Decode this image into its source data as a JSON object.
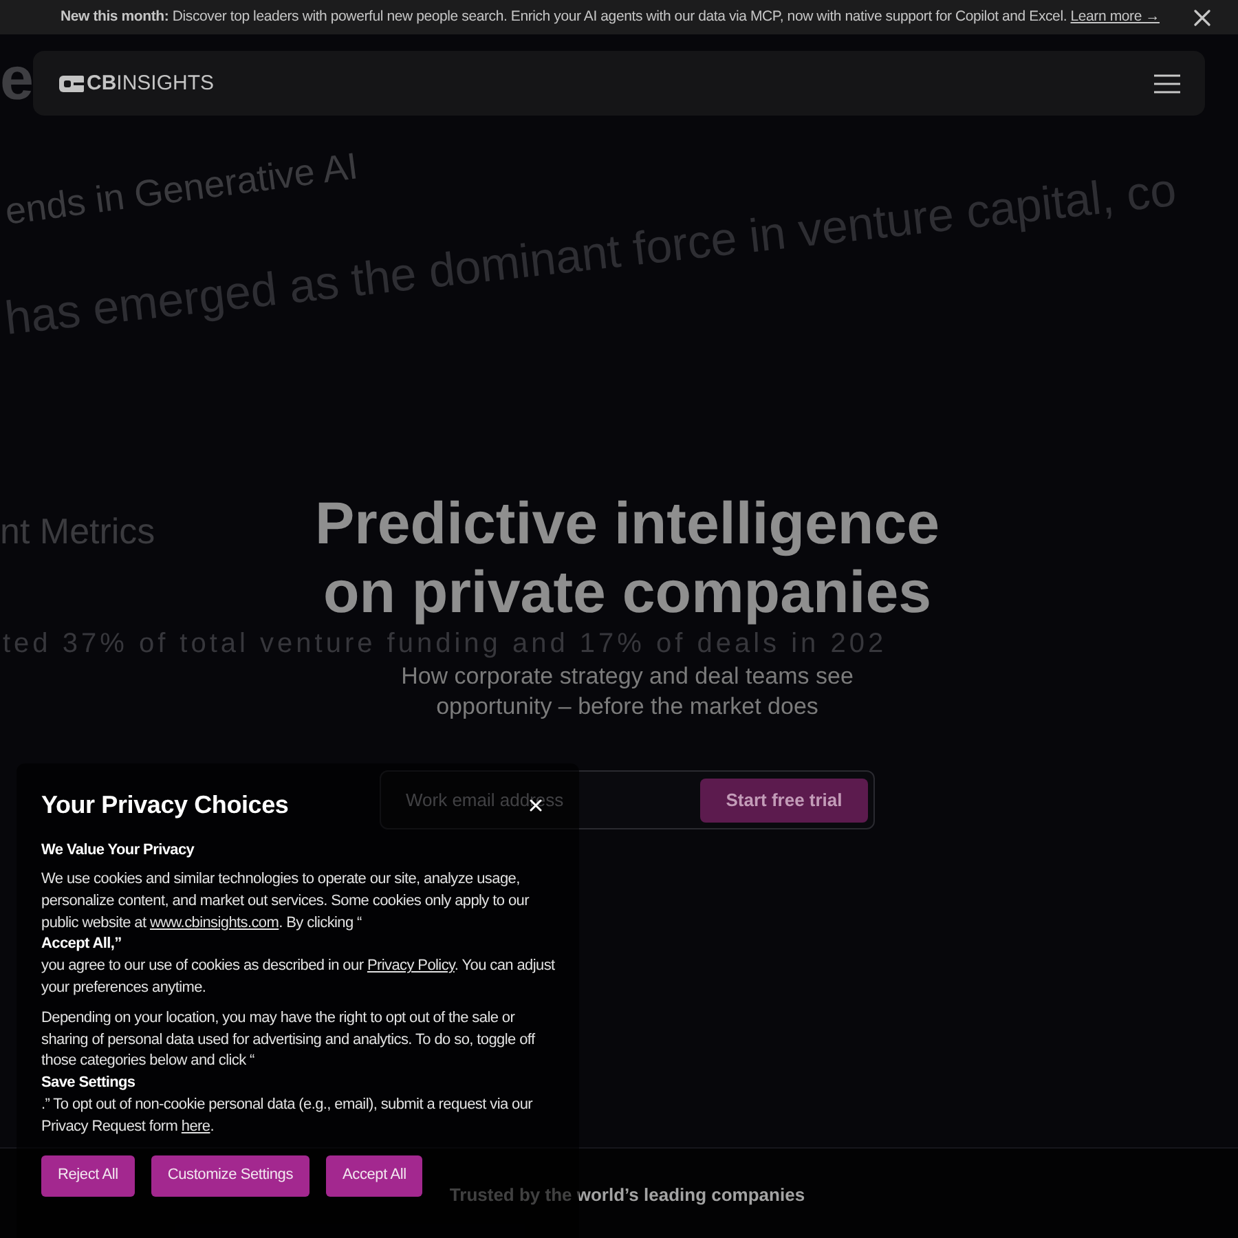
{
  "announcement": {
    "text": "**New this month:** Discover top leaders with powerful new people search. Enrich your AI agents with our data via MCP, now with native support for Copilot and Excel.",
    "link": "Learn more →"
  },
  "background_headlines": [
    {
      "text": "e"
    },
    {
      "text": "ends in Generative AI"
    },
    {
      "text": "has emerged as the dominant force in venture capital, co"
    },
    {
      "text": "nt Metrics"
    },
    {
      "text": "ted 37% of total venture funding and 17% of deals in 202"
    }
  ],
  "header": {
    "logo": "**CB**INSIGHTS"
  },
  "hero": {
    "title": "Predictive intelligence on private companies",
    "subtitle": "How corporate strategy and deal teams see opportunity – before the market does",
    "email_field": {
      "placeholder": "Work email address"
    },
    "cta": "Start free trial"
  },
  "trusted": {
    "text": "Trusted by the world’s leading companies"
  },
  "privacy_dialog": {
    "title": "Your Privacy Choices",
    "heading": "We Value Your Privacy",
    "paragraphs": [
      [
        {
          "kind": "paragraph",
          "parts": [
            {
              "kind": "text",
              "text": "We use cookies and similar technologies to operate our site, analyze usage, personalize content, and market out services. Some cookies only apply to our public website at "
            },
            {
              "kind": "link",
              "text": "www.cbinsights.com"
            },
            {
              "kind": "text",
              "text": ". By clicking “"
            }
          ]
        },
        {
          "kind": "emphasis",
          "text": "Accept All,”"
        },
        {
          "kind": "paragraph",
          "parts": [
            {
              "kind": "text",
              "text": "you agree to our use of cookies as described in our "
            },
            {
              "kind": "link",
              "text": "Privacy Policy"
            },
            {
              "kind": "text",
              "text": ". You can adjust your preferences anytime."
            }
          ]
        }
      ],
      [
        {
          "kind": "paragraph",
          "parts": [
            {
              "kind": "text",
              "text": "Depending on your location, you may have the right to opt out of the sale or sharing of personal data used for advertising and analytics. To do so, toggle off those categories below and click “"
            }
          ]
        },
        {
          "kind": "emphasis",
          "text": "Save Settings"
        },
        {
          "kind": "paragraph",
          "parts": [
            {
              "kind": "text",
              "text": ".” To opt out of non-cookie personal data (e.g., email), submit a request via our Privacy Request form "
            },
            {
              "kind": "link",
              "text": "here"
            },
            {
              "kind": "text",
              "text": "."
            }
          ]
        }
      ]
    ],
    "buttons": [
      "Reject All",
      "Customize Settings",
      "Accept All"
    ]
  }
}
